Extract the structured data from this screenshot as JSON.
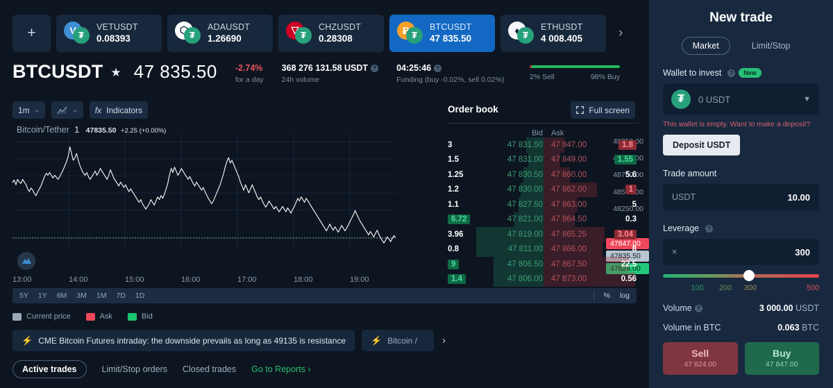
{
  "pair_tabs": {
    "add_label": "+",
    "next_arrow": "›",
    "items": [
      {
        "symbol": "VETUSDT",
        "price": "0.08393",
        "coin_letter": "V",
        "coin_color": "#3f8fd4",
        "quote_letter": "₮",
        "active": false
      },
      {
        "symbol": "ADAUSDT",
        "price": "1.26690",
        "coin_letter": "⬡",
        "coin_color": "#ffffff",
        "quote_letter": "₮",
        "active": false
      },
      {
        "symbol": "CHZUSDT",
        "price": "0.28308",
        "coin_letter": "▽",
        "coin_color": "#cd0124",
        "quote_letter": "₮",
        "active": false
      },
      {
        "symbol": "BTCUSDT",
        "price": "47 835.50",
        "coin_letter": "Ƀ",
        "coin_color": "#f7a12b",
        "quote_letter": "₮",
        "active": true
      },
      {
        "symbol": "ETHUSDT",
        "price": "4 008.405",
        "coin_letter": "♦",
        "coin_color": "#f4f6f9",
        "quote_letter": "₮",
        "active": false
      }
    ]
  },
  "price_header": {
    "symbol": "BTCUSDT",
    "star": "★",
    "price": "47 835.50",
    "change_value": "-2.74%",
    "change_label": "for a day",
    "volume_value": "368 276 131.58 USDT",
    "volume_label": "24h volume",
    "funding_value": "04:25:46",
    "funding_label": "Funding (buy -0.02%, sell 0.02%)",
    "sentiment": {
      "sell_label": "2% Sell",
      "buy_label": "98% Buy",
      "sell_pct": 2,
      "buy_pct": 98,
      "sell_color": "#c0392b",
      "buy_color": "#24b85f"
    }
  },
  "chart_toolbar": {
    "interval": "1m",
    "chart_type_icon": "candles-icon",
    "indicators": "Indicators",
    "indicators_icon": "fx",
    "full_screen": "Full screen",
    "chevron": "⌄"
  },
  "chart": {
    "overlay_title": "Bitcoin/Tether",
    "overlay_interval": "1",
    "overlay_price": "47835.50",
    "overlay_change": "+2.25 (+0.00%)",
    "logo_icon": "mountain-logo-icon",
    "tags": {
      "ask": "47847.00",
      "current": "47835.50",
      "bid": "47824.00"
    },
    "periods": [
      "5Y",
      "1Y",
      "6M",
      "3M",
      "1M",
      "7D",
      "1D"
    ],
    "scale_percent": "%",
    "scale_log": "log"
  },
  "chart_data": {
    "type": "line",
    "title": "Bitcoin/Tether",
    "xlabel": "",
    "ylabel": "",
    "ylim": [
      47700,
      49400
    ],
    "yticks": [
      "49250.00",
      "49000.00",
      "48750.00",
      "48500.00",
      "48250.00"
    ],
    "ytick_values": [
      49250,
      49000,
      48750,
      48500,
      48250
    ],
    "xticks": [
      "13:00",
      "14:00",
      "15:00",
      "16:00",
      "17:00",
      "18:00",
      "19:00"
    ],
    "grid": true,
    "legend": [
      {
        "label": "Current price",
        "color": "#9aa7b6"
      },
      {
        "label": "Ask",
        "color": "#f0495c"
      },
      {
        "label": "Bid",
        "color": "#19c66f"
      }
    ],
    "line_color": "#ffffff",
    "values": [
      48650,
      48690,
      48620,
      48700,
      48660,
      48640,
      48700,
      48660,
      48620,
      48560,
      48520,
      48570,
      48540,
      48490,
      48460,
      48520,
      48560,
      48610,
      48680,
      48740,
      48790,
      48760,
      48800,
      48760,
      48720,
      48760,
      48730,
      48700,
      48740,
      48790,
      48840,
      48900,
      48960,
      49040,
      49180,
      49080,
      48980,
      49020,
      49080,
      48980,
      48900,
      48840,
      48790,
      48760,
      48800,
      48740,
      48700,
      48740,
      48780,
      48820,
      48760,
      48800,
      48860,
      48820,
      48780,
      48740,
      48700,
      48760,
      48840,
      48780,
      48720,
      48680,
      48640,
      48600,
      48660,
      48620,
      48580,
      48620,
      48560,
      48520,
      48560,
      48520,
      48480,
      48440,
      48400,
      48360,
      48400,
      48340,
      48300,
      48260,
      48300,
      48340,
      48400,
      48360,
      48320,
      48380,
      48440,
      48400,
      48460,
      48420,
      48480,
      48560,
      48640,
      48760,
      48860,
      48800,
      48880,
      48820,
      48760,
      48800,
      48860,
      48820,
      48780,
      48740,
      48700,
      48740,
      48690,
      48640,
      48600,
      48660,
      48620,
      48580,
      48540,
      48580,
      48520,
      48470,
      48420,
      48380,
      48340,
      48380,
      48440,
      48500,
      48560,
      48620,
      48700,
      48780,
      48880,
      48960,
      49020,
      48940,
      48980,
      48920,
      48860,
      48800,
      48740,
      48660,
      48600,
      48540,
      48620,
      48560,
      48500,
      48560,
      48620,
      48560,
      48500,
      48440,
      48400,
      48440,
      48380,
      48330,
      48290,
      48330,
      48380,
      48340,
      48300,
      48260,
      48300,
      48260,
      48220,
      48260,
      48300,
      48260,
      48220,
      48280,
      48240,
      48200,
      48260,
      48300,
      48360,
      48420,
      48380,
      48440,
      48400,
      48360,
      48420,
      48380,
      48340,
      48300,
      48260,
      48220,
      48180,
      48140,
      48100,
      48060,
      48020,
      47980,
      47940,
      47990,
      48040,
      47990,
      47950,
      48000,
      47960,
      47920,
      47970,
      48020,
      47980,
      47940,
      47980,
      48030,
      48080,
      48130,
      48180,
      48240,
      48180,
      48130,
      48080,
      48040,
      48000,
      47960,
      47920,
      47880,
      47930,
      47890,
      47850,
      47900,
      47950,
      47890,
      47840,
      47800,
      47760,
      47800,
      47850,
      47820,
      47780,
      47830,
      47870,
      47835
    ]
  },
  "order_book": {
    "title": "Order book",
    "col_bid": "Bid",
    "col_ask": "Ask",
    "rows": [
      {
        "bid_qty": "3",
        "bid_price": "47 831.50",
        "ask_price": "47 847.00",
        "ask_qty": "1.8",
        "bid_depth": 18,
        "ask_depth": 22,
        "bid_hl": null,
        "ask_hl": "r"
      },
      {
        "bid_qty": "1.5",
        "bid_price": "47 831.00",
        "ask_price": "47 849.00",
        "ask_qty": "1.55",
        "bid_depth": 16,
        "ask_depth": 18,
        "bid_hl": null,
        "ask_hl": "g"
      },
      {
        "bid_qty": "1.25",
        "bid_price": "47 830.50",
        "ask_price": "47 860.00",
        "ask_qty": "5.6",
        "bid_depth": 21,
        "ask_depth": 28,
        "bid_hl": null,
        "ask_hl": null
      },
      {
        "bid_qty": "1.2",
        "bid_price": "47 830.00",
        "ask_price": "47 862.00",
        "ask_qty": "1",
        "bid_depth": 24,
        "ask_depth": 56,
        "bid_hl": null,
        "ask_hl": "r"
      },
      {
        "bid_qty": "1.1",
        "bid_price": "47 827.50",
        "ask_price": "47 863.00",
        "ask_qty": "5",
        "bid_depth": 26,
        "ask_depth": 36,
        "bid_hl": null,
        "ask_hl": null
      },
      {
        "bid_qty": "6.72",
        "bid_price": "47 821.00",
        "ask_price": "47 864.50",
        "ask_qty": "0.3",
        "bid_depth": 30,
        "ask_depth": 33,
        "bid_hl": "g",
        "ask_hl": null
      },
      {
        "bid_qty": "3.96",
        "bid_price": "47 819.00",
        "ask_price": "47 865.25",
        "ask_qty": "3.04",
        "bid_depth": 70,
        "ask_depth": 64,
        "bid_hl": null,
        "ask_hl": "r"
      },
      {
        "bid_qty": "0.8",
        "bid_price": "47 811.00",
        "ask_price": "47 866.00",
        "ask_qty": "8",
        "bid_depth": 70,
        "ask_depth": 62,
        "bid_hl": null,
        "ask_hl": null
      },
      {
        "bid_qty": "9",
        "bid_price": "47 806.50",
        "ask_price": "47 867.50",
        "ask_qty": "22.5",
        "bid_depth": 52,
        "ask_depth": 90,
        "bid_hl": "g",
        "ask_hl": null
      },
      {
        "bid_qty": "1.4",
        "bid_price": "47 806.00",
        "ask_price": "47 873.00",
        "ask_qty": "0.56",
        "bid_depth": 52,
        "ask_depth": 96,
        "bid_hl": "g",
        "ask_hl": null
      }
    ]
  },
  "news": {
    "items": [
      {
        "text": "CME Bitcoin Futures intraday: the downside prevails as long as 49135 is resistance",
        "partial": false
      },
      {
        "text": "Bitcoin /",
        "partial": true
      }
    ],
    "next_arrow": "›"
  },
  "bottom_tabs": {
    "items": [
      {
        "label": "Active trades",
        "active": true,
        "link": false
      },
      {
        "label": "Limit/Stop orders",
        "active": false,
        "link": false
      },
      {
        "label": "Closed trades",
        "active": false,
        "link": false
      },
      {
        "label": "Go to Reports ›",
        "active": false,
        "link": true
      }
    ]
  },
  "new_trade": {
    "title": "New trade",
    "modes": [
      {
        "label": "Market",
        "active": true
      },
      {
        "label": "Limit/Stop",
        "active": false
      }
    ],
    "wallet_label": "Wallet to invest",
    "wallet_badge": "New",
    "wallet_value": "0 USDT",
    "wallet_icon": "tether-icon",
    "wallet_warning": "This wallet is empty. Want to make a deposit?",
    "deposit_button": "Deposit USDT",
    "amount_label": "Trade amount",
    "amount_placeholder": "USDT",
    "amount_value": "10.00",
    "leverage_label": "Leverage",
    "leverage_prefix": "×",
    "leverage_value": "300",
    "leverage_ticks": [
      {
        "label": "100",
        "pos": 22,
        "color": "#2c9c68"
      },
      {
        "label": "200",
        "pos": 40,
        "color": "#6b8f5c"
      },
      {
        "label": "300",
        "pos": 56,
        "color": "#9c8a59"
      },
      {
        "label": "500",
        "pos": 96,
        "color": "#d9515f"
      }
    ],
    "volume_label": "Volume",
    "volume_value": "3 000.00",
    "volume_unit": "USDT",
    "volume_btc_label": "Volume in BTC",
    "volume_btc_value": "0.063",
    "volume_btc_unit": "BTC",
    "sell_label": "Sell",
    "sell_price": "47 824.00",
    "buy_label": "Buy",
    "buy_price": "47 847.00"
  }
}
